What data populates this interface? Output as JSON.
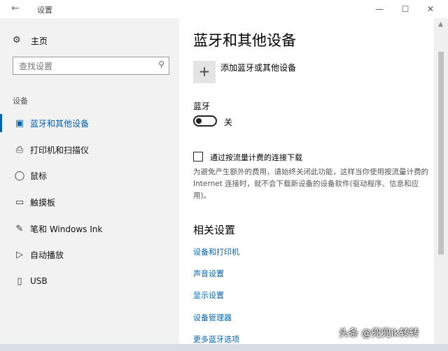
{
  "window": {
    "title": "设置",
    "back_glyph": "←",
    "min_glyph": "—",
    "max_glyph": "☐",
    "close_glyph": "✕"
  },
  "nav": {
    "home_label": "主页",
    "search_placeholder": "查找设置",
    "section_label": "设备",
    "items": [
      {
        "label": "蓝牙和其他设备",
        "icon": "bluetooth-devices-icon",
        "active": true
      },
      {
        "label": "打印机和扫描仪",
        "icon": "printer-icon",
        "active": false
      },
      {
        "label": "鼠标",
        "icon": "mouse-icon",
        "active": false
      },
      {
        "label": "触摸板",
        "icon": "touchpad-icon",
        "active": false
      },
      {
        "label": "笔和 Windows Ink",
        "icon": "pen-icon",
        "active": false
      },
      {
        "label": "自动播放",
        "icon": "autoplay-icon",
        "active": false
      },
      {
        "label": "USB",
        "icon": "usb-icon",
        "active": false
      }
    ]
  },
  "main": {
    "title": "蓝牙和其他设备",
    "add_device_label": "添加蓝牙或其他设备",
    "bluetooth_label": "蓝牙",
    "bluetooth_state": "关",
    "bluetooth_on": false,
    "metered_label": "通过按流量计费的连接下载",
    "metered_checked": false,
    "metered_desc": "为避免产生额外的费用，请始终关闭此功能，这样当你使用按流量计费的 Internet 连接时，就不会下载新设备的设备软件(驱动程序、信息和应用)。",
    "related_title": "相关设置",
    "related_links": [
      "设备和打印机",
      "声音设置",
      "显示设置",
      "设备管理器",
      "更多蓝牙选项"
    ]
  },
  "watermark": "头条 @兜兜ik转转",
  "colors": {
    "accent": "#0063b1",
    "nav_bg": "#f2f2f2",
    "content_bg": "#ffffff"
  }
}
